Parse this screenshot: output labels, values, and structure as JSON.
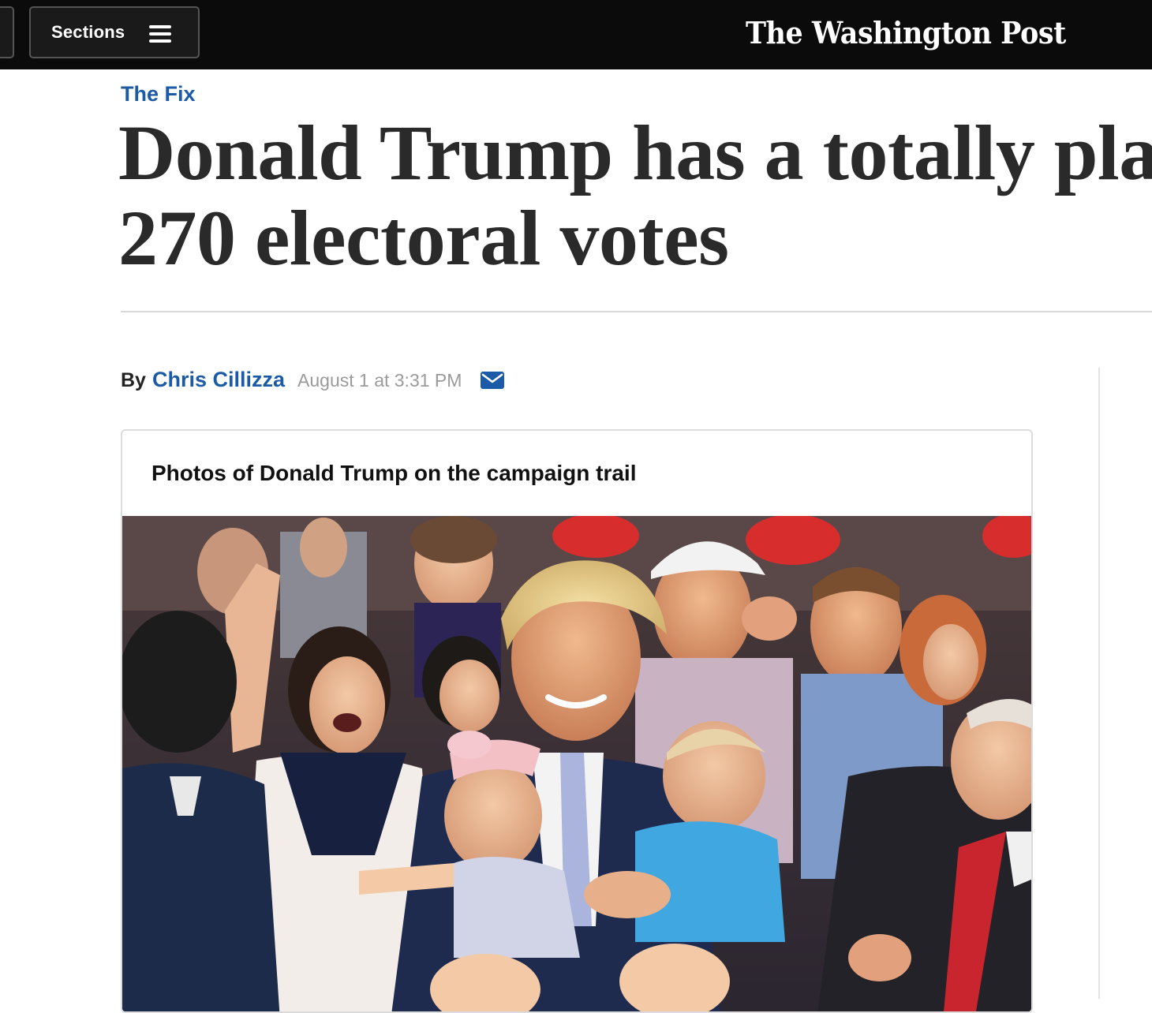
{
  "nav": {
    "sections_label": "Sections",
    "brand": "The Washington Post"
  },
  "article": {
    "kicker": "The Fix",
    "headline_line1": "Donald Trump has a totally plau",
    "headline_line2": "270 electoral votes",
    "byline": {
      "prefix": "By",
      "author": "Chris Cillizza",
      "timestamp": "August 1 at 3:31 PM",
      "share_icon": "mail-icon"
    }
  },
  "gallery": {
    "title": "Photos of Donald Trump on the campaign trail",
    "photo_icon": "campaign-rally-photo"
  },
  "colors": {
    "topbar_bg": "#0b0b0b",
    "link_blue": "#1a5aa6",
    "headline": "#2a2a2a",
    "timestamp": "#9a9a9a"
  }
}
